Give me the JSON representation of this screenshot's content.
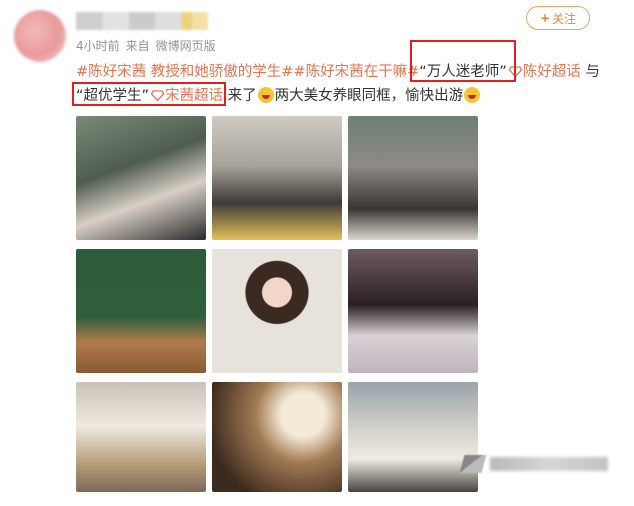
{
  "post": {
    "time": "4小时前",
    "source_prefix": "来自",
    "source": "微博网页版",
    "follow_label": "关注",
    "text": {
      "hashtag1": "#陈好宋茜 教授和她骄傲的学生#",
      "hashtag2": "#陈好宋茜在干嘛#",
      "quote1": "“万人迷老师”",
      "mention1": "陈好超话",
      "conj": " 与",
      "quote2": "“超优学生”",
      "mention2": "宋茜超话",
      "suffix": " 来了",
      "tail": "两大美女养眼同框，愉快出游"
    }
  },
  "images": [
    "photo-seated-duo-1",
    "photo-press-event",
    "photo-seated-duo-2",
    "photo-lecture-podium",
    "photo-portrait-brand",
    "photo-portrait-long-hair",
    "photo-street-white-jacket-1",
    "photo-portrait-warm-light",
    "photo-street-white-jacket-2"
  ],
  "colors": {
    "accent": "#eb7350",
    "highlight_box": "#e02020",
    "follow": "#e8863a"
  },
  "icons": [
    "super-topic-icon",
    "laugh-emoji-icon",
    "grin-emoji-icon",
    "plus-icon"
  ]
}
